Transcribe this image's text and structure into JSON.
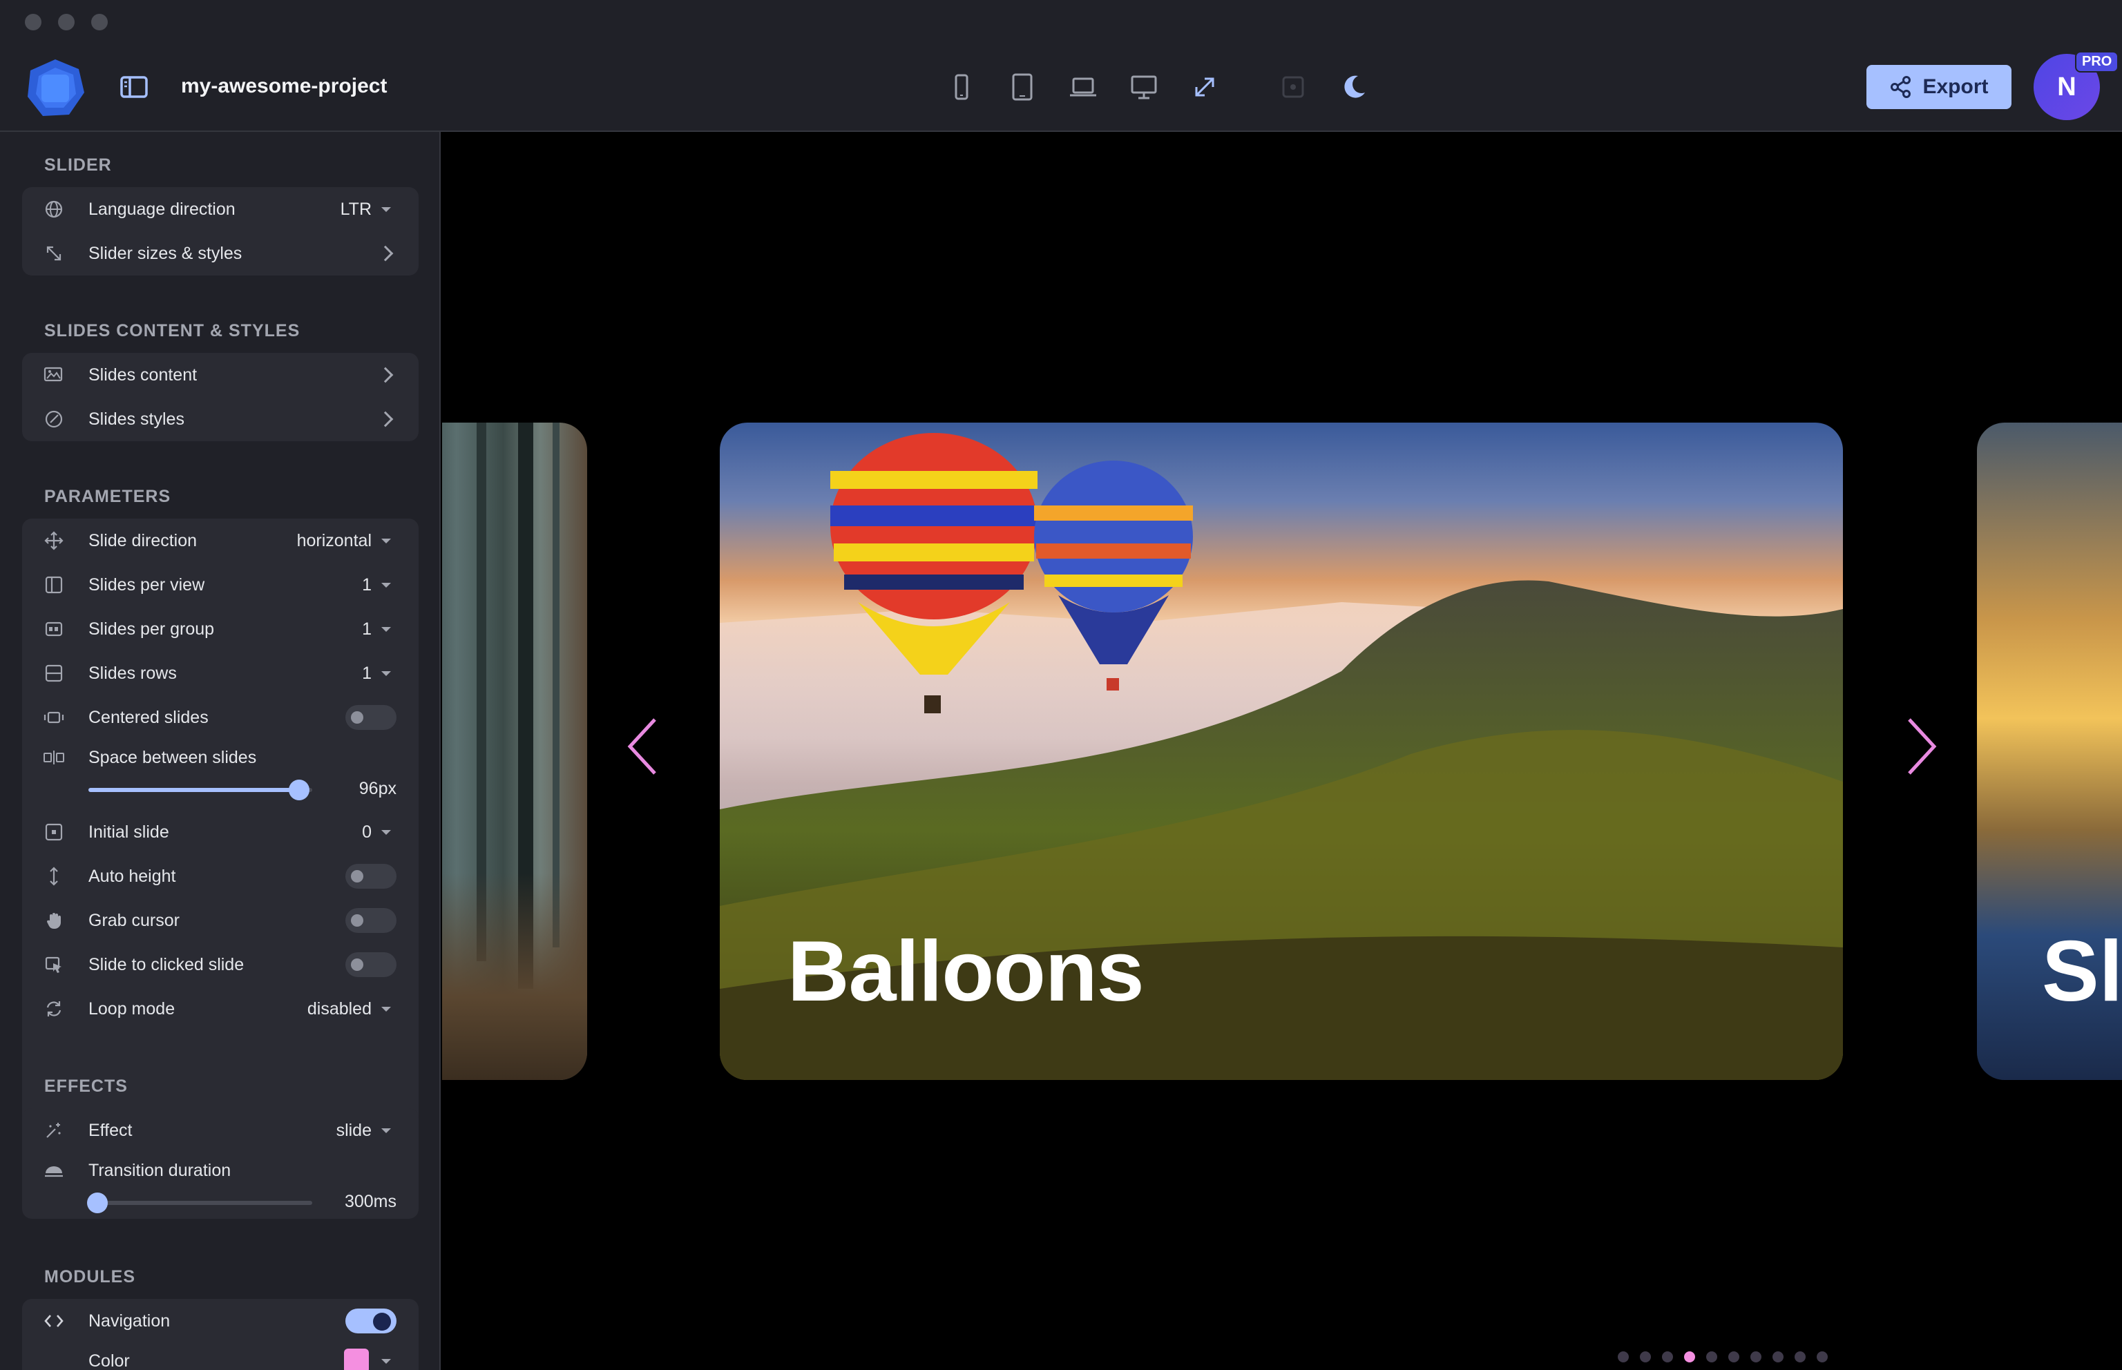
{
  "header": {
    "project_name": "my-awesome-project",
    "export_label": "Export",
    "avatar_initial": "N",
    "pro_badge": "PRO",
    "device_icons": [
      "phone-icon",
      "tablet-icon",
      "laptop-icon",
      "desktop-icon",
      "fullscreen-icon"
    ],
    "accent_color": "#a6c0ff"
  },
  "sidebar": {
    "slider": {
      "title": "SLIDER",
      "language_direction": {
        "label": "Language direction",
        "value": "LTR"
      },
      "sizes_styles": {
        "label": "Slider sizes & styles"
      }
    },
    "slides_content_styles": {
      "title": "SLIDES CONTENT & STYLES",
      "content": {
        "label": "Slides content"
      },
      "styles": {
        "label": "Slides styles"
      }
    },
    "parameters": {
      "title": "PARAMETERS",
      "slide_direction": {
        "label": "Slide direction",
        "value": "horizontal"
      },
      "slides_per_view": {
        "label": "Slides per view",
        "value": "1"
      },
      "slides_per_group": {
        "label": "Slides per group",
        "value": "1"
      },
      "slides_rows": {
        "label": "Slides rows",
        "value": "1"
      },
      "centered_slides": {
        "label": "Centered slides",
        "enabled": false
      },
      "space_between": {
        "label": "Space between slides",
        "value": "96px",
        "fraction": 0.94
      },
      "initial_slide": {
        "label": "Initial slide",
        "value": "0"
      },
      "auto_height": {
        "label": "Auto height",
        "enabled": false
      },
      "grab_cursor": {
        "label": "Grab cursor",
        "enabled": false
      },
      "slide_to_clicked": {
        "label": "Slide to clicked slide",
        "enabled": false
      },
      "loop_mode": {
        "label": "Loop mode",
        "value": "disabled"
      }
    },
    "effects": {
      "title": "EFFECTS",
      "effect": {
        "label": "Effect",
        "value": "slide"
      },
      "transition_duration": {
        "label": "Transition duration",
        "value": "300ms",
        "fraction": 0.04
      }
    },
    "modules": {
      "title": "MODULES",
      "navigation": {
        "label": "Navigation",
        "enabled": true
      },
      "color": {
        "label": "Color",
        "swatch": "#f48fe0"
      }
    }
  },
  "preview": {
    "current_slide_title": "Balloons",
    "next_slide_title": "Sl",
    "pagination_count": 10,
    "pagination_active": 3,
    "nav_color": "#e88ae0"
  }
}
